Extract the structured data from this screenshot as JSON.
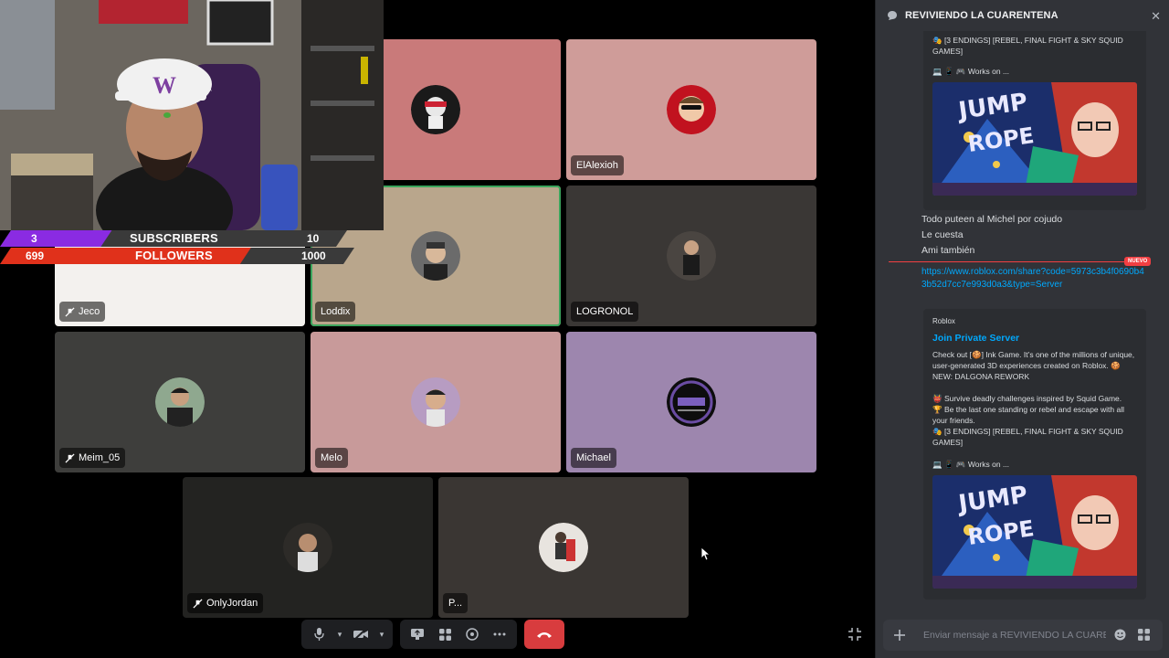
{
  "stream_overlay": {
    "subscribers": {
      "current": "3",
      "label": "SUBSCRIBERS",
      "goal": "10",
      "progress": 0.3
    },
    "followers": {
      "current": "699",
      "label": "FOLLOWERS",
      "goal": "1000",
      "progress": 0.699
    }
  },
  "participants": [
    {
      "name": "",
      "bg": "#c97a7a",
      "muted": false,
      "speaking": false
    },
    {
      "name": "ElAlexioh",
      "bg": "#cf9c99",
      "muted": false,
      "speaking": false
    },
    {
      "name": "Jeco",
      "bg": "#f3f1ee",
      "muted": true,
      "speaking": false
    },
    {
      "name": "Loddix",
      "bg": "#b9a68c",
      "muted": false,
      "speaking": true
    },
    {
      "name": "LOGRONOL",
      "bg": "#3a3735",
      "muted": false,
      "speaking": false
    },
    {
      "name": "Meim_05",
      "bg": "#3e3e3c",
      "muted": true,
      "speaking": false
    },
    {
      "name": "Melo",
      "bg": "#c89a9a",
      "muted": false,
      "speaking": false
    },
    {
      "name": "Michael",
      "bg": "#9d86ae",
      "muted": false,
      "speaking": false
    },
    {
      "name": "OnlyJordan",
      "bg": "#232321",
      "muted": true,
      "speaking": false
    },
    {
      "name": "P...",
      "bg": "#3a3633",
      "muted": false,
      "speaking": false
    }
  ],
  "controls": {
    "mic_icon": "microphone-icon",
    "camera_icon": "camera-off-icon",
    "screenshare_icon": "screen-share-icon",
    "activities_icon": "activities-icon",
    "soundboard_icon": "soundboard-icon",
    "more_icon": "more-icon",
    "end_call_icon": "phone-hangup-icon",
    "end_call_color": "#d83c3e"
  },
  "chat": {
    "title": "REVIVIENDO LA CUARENTENA",
    "embed_top": {
      "endings": "🎭 [3 ENDINGS] [REBEL, FINAL FIGHT & SKY SQUID GAMES]",
      "works_on": "💻 📱 🎮 Works on ..."
    },
    "messages": [
      "Todo puteen al Michel por cojudo",
      "Le cuesta",
      "Ami también"
    ],
    "new_label": "NUEVO",
    "link": "https://www.roblox.com/share?code=5973c3b4f0690b43b52d7cc7e993d0a3&type=Server",
    "embed": {
      "provider": "Roblox",
      "title": "Join Private Server",
      "description": "Check out [🍪] Ink Game. It’s one of the millions of unique, user-generated 3D experiences created on Roblox. 🍪 NEW: DALGONA REWORK",
      "line1": "👹 Survive deadly challenges inspired by Squid Game.",
      "line2": "🏆 Be the last one standing or rebel and escape with all your friends.",
      "line3": "🎭 [3 ENDINGS] [REBEL, FINAL FIGHT & SKY SQUID GAMES]",
      "works_on": "💻 📱 🎮 Works on ...",
      "image_text": "JUMP ROPE"
    },
    "composer_placeholder": "Enviar mensaje a REVIVIENDO LA CUARENTENA",
    "accent": "#00a8fc",
    "embed_title_color": "#00a8fc"
  }
}
